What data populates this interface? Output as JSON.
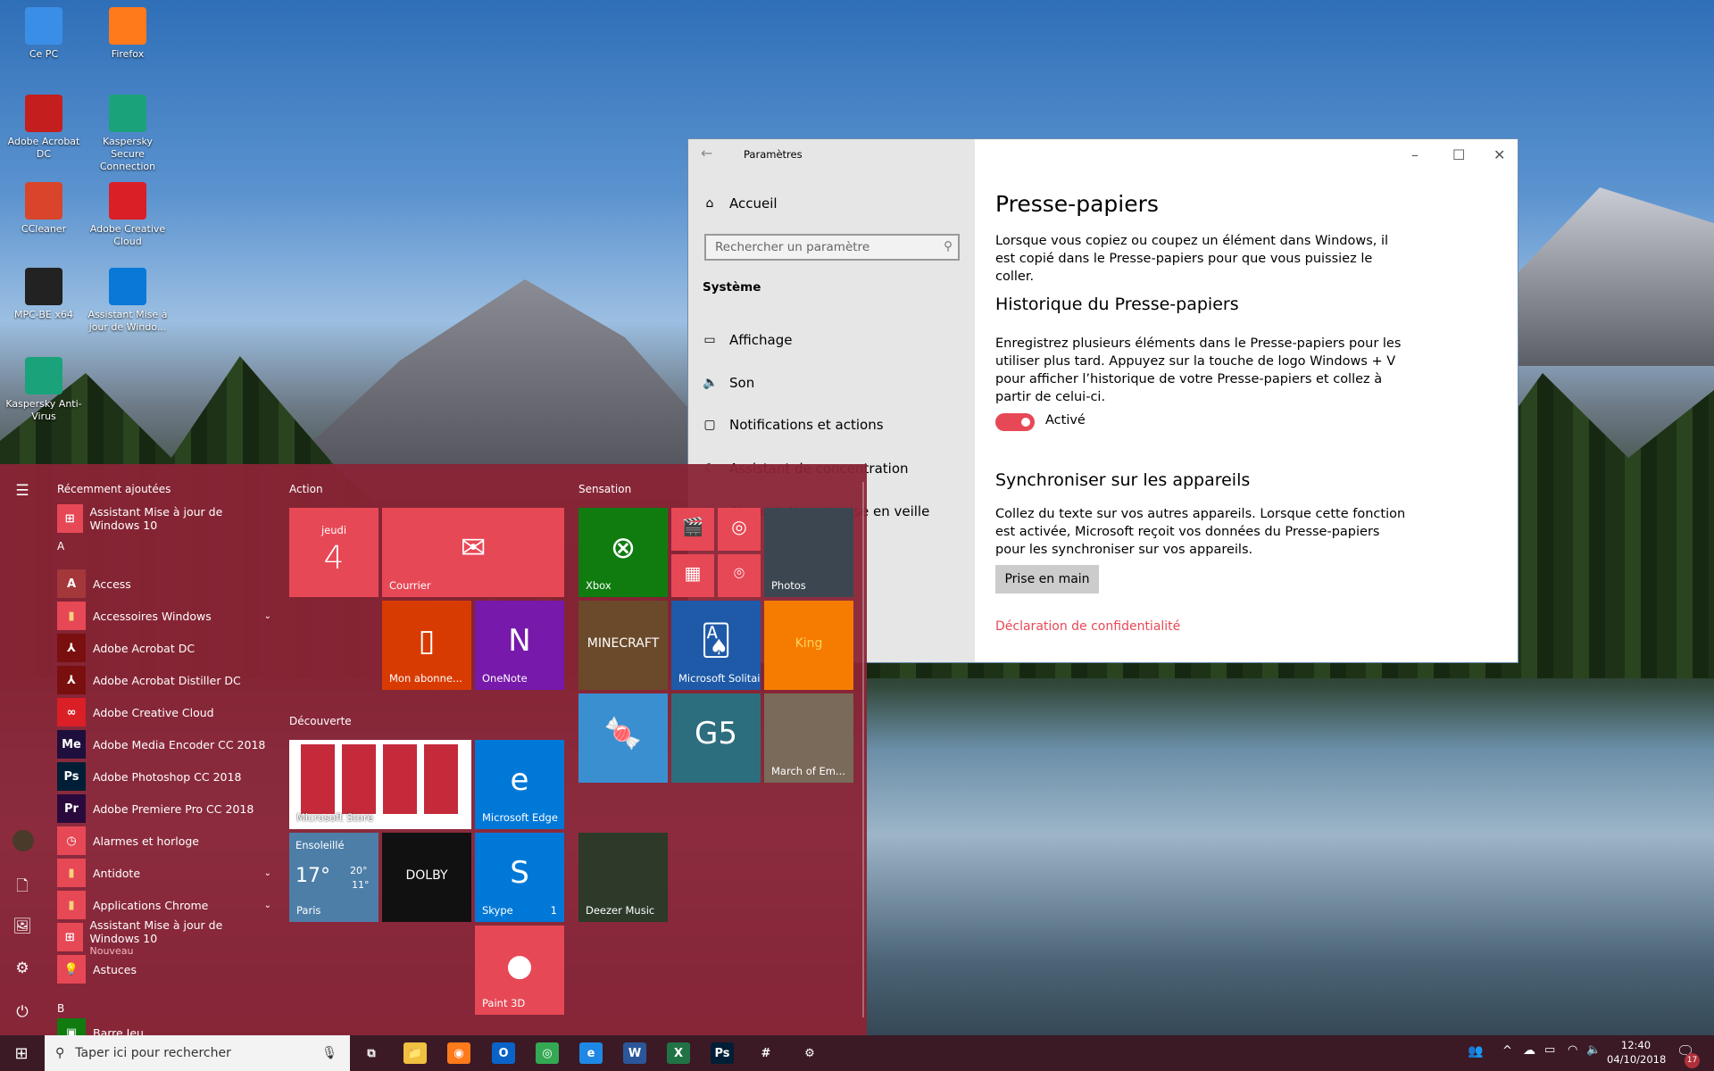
{
  "desktop": {
    "icons": [
      {
        "label": "Ce PC",
        "color": "#3a8ee6"
      },
      {
        "label": "Firefox",
        "color": "#ff7a1a"
      },
      {
        "label": "Adobe Acrobat DC",
        "color": "#c41e1e"
      },
      {
        "label": "Kaspersky Secure Connection",
        "color": "#1aa37a"
      },
      {
        "label": "CCleaner",
        "color": "#d9452b"
      },
      {
        "label": "Adobe Creative Cloud",
        "color": "#da1f26"
      },
      {
        "label": "MPC-BE x64",
        "color": "#222222"
      },
      {
        "label": "Assistant Mise à jour de Windo...",
        "color": "#0a78d7"
      },
      {
        "label": "Kaspersky Anti-Virus",
        "color": "#1aa37a"
      }
    ]
  },
  "settings": {
    "title": "Paramètres",
    "home": "Accueil",
    "search_placeholder": "Rechercher un paramètre",
    "section": "Système",
    "nav": [
      "Affichage",
      "Son",
      "Notifications et actions",
      "Assistant de concentration",
      "Alimentation et mise en veille"
    ],
    "page_title": "Presse-papiers",
    "intro": "Lorsque vous copiez ou coupez un élément dans Windows, il est copié dans le Presse-papiers pour que vous puissiez le coller.",
    "history_title": "Historique du Presse-papiers",
    "history_text": "Enregistrez plusieurs éléments dans le Presse-papiers pour les utiliser plus tard. Appuyez sur la touche de logo Windows + V pour afficher l’historique de votre Presse-papiers et collez à partir de celui-ci.",
    "toggle_label": "Activé",
    "toggle_on": true,
    "sync_title": "Synchroniser sur les appareils",
    "sync_text": "Collez du texte sur vos autres appareils. Lorsque cette fonction est activée, Microsoft reçoit vos données du Presse-papiers pour les synchroniser sur vos appareils.",
    "sync_button": "Prise en main",
    "privacy_link": "Déclaration de confidentialité",
    "accent": "#e74856"
  },
  "start": {
    "recent_header": "Récemment ajoutées",
    "list": [
      {
        "type": "item",
        "label": "Assistant Mise à jour de Windows 10",
        "icon": "windows"
      },
      {
        "type": "header",
        "label": "A"
      },
      {
        "type": "item",
        "label": "Access",
        "icon": "A"
      },
      {
        "type": "item",
        "label": "Accessoires Windows",
        "icon": "folder",
        "expand": true
      },
      {
        "type": "item",
        "label": "Adobe Acrobat DC",
        "icon": "acrobat"
      },
      {
        "type": "item",
        "label": "Adobe Acrobat Distiller DC",
        "icon": "acrobat"
      },
      {
        "type": "item",
        "label": "Adobe Creative Cloud",
        "icon": "cc"
      },
      {
        "type": "item",
        "label": "Adobe Media Encoder CC 2018",
        "icon": "Me"
      },
      {
        "type": "item",
        "label": "Adobe Photoshop CC 2018",
        "icon": "Ps"
      },
      {
        "type": "item",
        "label": "Adobe Premiere Pro CC 2018",
        "icon": "Pr"
      },
      {
        "type": "item",
        "label": "Alarmes et horloge",
        "icon": "clock"
      },
      {
        "type": "item",
        "label": "Antidote",
        "icon": "folder",
        "expand": true
      },
      {
        "type": "item",
        "label": "Applications Chrome",
        "icon": "folder",
        "expand": true
      },
      {
        "type": "item",
        "label": "Assistant Mise à jour de Windows 10",
        "sub": "Nouveau",
        "icon": "windows"
      },
      {
        "type": "item",
        "label": "Astuces",
        "icon": "bulb"
      },
      {
        "type": "header",
        "label": "B"
      },
      {
        "type": "item",
        "label": "Barre Jeu",
        "icon": "game"
      }
    ],
    "groups": [
      "Action",
      "Sensation",
      "Découverte"
    ],
    "tiles": [
      {
        "id": "calendar",
        "label": "jeudi",
        "big": "4",
        "color": "#e74856"
      },
      {
        "id": "mail",
        "label": "Courrier",
        "glyph": "✉",
        "color": "#e74856"
      },
      {
        "id": "office",
        "label": "Mon abonne...",
        "glyph": "▯",
        "color": "#d83b01"
      },
      {
        "id": "onenote",
        "label": "OneNote",
        "glyph": "N",
        "color": "#7719aa"
      },
      {
        "id": "xbox",
        "label": "Xbox",
        "glyph": "⊗",
        "color": "#107c10"
      },
      {
        "id": "movies",
        "label": "",
        "glyph": "🎬",
        "color": "#e74856"
      },
      {
        "id": "groove",
        "label": "",
        "glyph": "◎",
        "color": "#e74856"
      },
      {
        "id": "calculator",
        "label": "",
        "glyph": "▦",
        "color": "#e74856"
      },
      {
        "id": "maps",
        "label": "",
        "glyph": "⌾",
        "color": "#e74856"
      },
      {
        "id": "photos",
        "label": "Photos",
        "glyph": "",
        "color": "#3c4650"
      },
      {
        "id": "minecraft",
        "label": "",
        "glyph": "MINECRAFT",
        "color": "#6b4a2b"
      },
      {
        "id": "solitaire",
        "label": "Microsoft Solitaire Collection",
        "glyph": "🂡",
        "color": "#1e5aa8"
      },
      {
        "id": "king",
        "label": "",
        "glyph": "King",
        "color": "#f57c00"
      },
      {
        "id": "candy",
        "label": "",
        "glyph": "🍬",
        "color": "#3a8fd0"
      },
      {
        "id": "g5",
        "label": "",
        "glyph": "G5",
        "color": "#2d6e7e"
      },
      {
        "id": "march",
        "label": "March of Em...",
        "glyph": "",
        "color": "#7a6a5a"
      },
      {
        "id": "store",
        "label": "Microsoft Store",
        "glyph": "",
        "color": "#d93d4c"
      },
      {
        "id": "edge",
        "label": "Microsoft Edge",
        "glyph": "e",
        "color": "#0078d7"
      },
      {
        "id": "weather",
        "label": "Paris",
        "color": "#4d7ea8",
        "condition": "Ensoleillé",
        "temp": "17°",
        "high": "20°",
        "low": "11°"
      },
      {
        "id": "dolby",
        "label": "",
        "glyph": "DOLBY",
        "color": "#111111"
      },
      {
        "id": "skype",
        "label": "Skype",
        "glyph": "S",
        "color": "#0078d7",
        "badge": "1"
      },
      {
        "id": "deezer",
        "label": "Deezer Music",
        "glyph": "",
        "color": "#2d3a2a"
      },
      {
        "id": "paint3d",
        "label": "Paint 3D",
        "glyph": "●",
        "color": "#e74856"
      }
    ]
  },
  "taskbar": {
    "search_placeholder": "Taper ici pour rechercher",
    "time": "12:40",
    "date": "04/10/2018",
    "notif_count": "17",
    "apps": [
      "task-view",
      "file-explorer",
      "firefox",
      "outlook",
      "chrome",
      "edge",
      "word",
      "excel",
      "photoshop",
      "slack",
      "settings"
    ]
  }
}
